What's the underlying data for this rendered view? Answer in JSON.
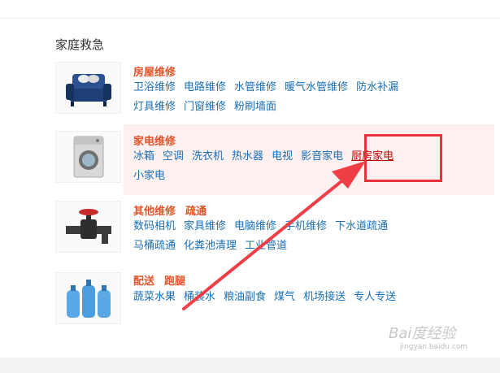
{
  "section_title": "家庭救急",
  "categories": [
    {
      "title_parts": [
        "房屋维修"
      ],
      "links": [
        "卫浴维修",
        "电路维修",
        "水管维修",
        "暖气水管维修",
        "防水补漏",
        "灯具维修",
        "门窗维修",
        "粉刷墙面"
      ],
      "image": "sofa-icon"
    },
    {
      "title_parts": [
        "家电维修"
      ],
      "links": [
        "冰箱",
        "空调",
        "洗衣机",
        "热水器",
        "电视",
        "影音家电",
        "厨房家电",
        "小家电"
      ],
      "image": "washing-machine-icon",
      "highlighted_link": "厨房家电"
    },
    {
      "title_parts": [
        "其他维修",
        "疏通"
      ],
      "links": [
        "数码相机",
        "家具维修",
        "电脑维修",
        "手机维修",
        "下水道疏通",
        "马桶疏通",
        "化粪池清理",
        "工业管道"
      ],
      "image": "water-valve-icon"
    },
    {
      "title_parts": [
        "配送",
        "跑腿"
      ],
      "links": [
        "蔬菜水果",
        "桶装水",
        "粮油副食",
        "煤气",
        "机场接送",
        "专人专送"
      ],
      "image": "water-bottles-icon"
    }
  ],
  "watermark": {
    "brand": "Bai度经验",
    "url": "jingyan.baidu.com"
  },
  "colors": {
    "category_title": "#e4542a",
    "link": "#1a6fb5",
    "annotation": "#e8323c",
    "highlight_bg": "#fff0f0"
  }
}
